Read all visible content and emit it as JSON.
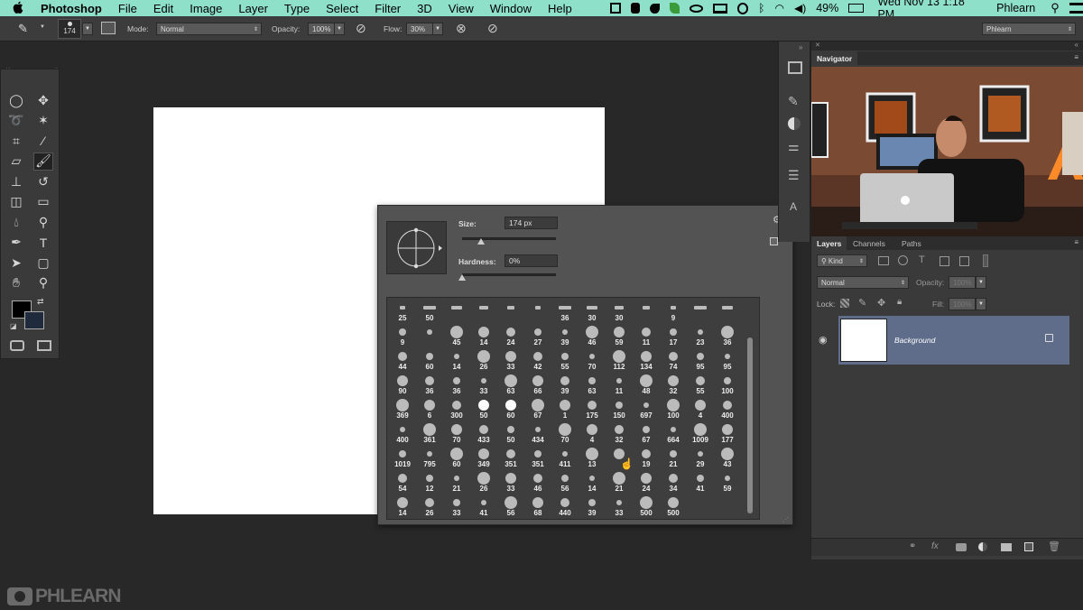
{
  "menubar": {
    "apple_icon": "apple-icon",
    "items": [
      "Photoshop",
      "File",
      "Edit",
      "Image",
      "Layer",
      "Type",
      "Select",
      "Filter",
      "3D",
      "View",
      "Window",
      "Help"
    ],
    "battery": "49%",
    "clock": "Wed Nov 13  1:18 PM",
    "user": "Phlearn"
  },
  "options": {
    "brush_size": "174",
    "mode_label": "Mode:",
    "mode_value": "Normal",
    "opacity_label": "Opacity:",
    "opacity_value": "100%",
    "flow_label": "Flow:",
    "flow_value": "30%",
    "workspace": "Phlearn"
  },
  "toolbox": {
    "tools": [
      "marquee-icon",
      "move-icon",
      "lasso-icon",
      "magic-wand-icon",
      "crop-icon",
      "eyedropper-icon",
      "healing-brush-icon",
      "brush-icon",
      "clone-stamp-icon",
      "history-brush-icon",
      "eraser-icon",
      "gradient-icon",
      "blur-icon",
      "dodge-icon",
      "pen-icon",
      "type-icon",
      "path-selection-icon",
      "rectangle-icon",
      "hand-icon",
      "zoom-icon"
    ],
    "foreground": "#000000",
    "background": "#1f2a3d"
  },
  "brush_picker": {
    "size_label": "Size:",
    "size_value": "174 px",
    "size_fraction": 0.2,
    "hardness_label": "Hardness:",
    "hardness_value": "0%",
    "hardness_fraction": 0,
    "rows": [
      [
        "25",
        "50",
        "",
        "",
        "",
        "",
        "36",
        "30",
        "30",
        "",
        "9",
        "",
        ""
      ],
      [
        "9",
        "",
        "45",
        "14",
        "24",
        "27",
        "39",
        "46",
        "59",
        "11",
        "17",
        "23",
        "36"
      ],
      [
        "44",
        "60",
        "14",
        "26",
        "33",
        "42",
        "55",
        "70",
        "112",
        "134",
        "74",
        "95",
        "95"
      ],
      [
        "90",
        "36",
        "36",
        "33",
        "63",
        "66",
        "39",
        "63",
        "11",
        "48",
        "32",
        "55",
        "100"
      ],
      [
        "369",
        "6",
        "300",
        "50",
        "60",
        "67",
        "1",
        "175",
        "150",
        "697",
        "100",
        "4",
        "400"
      ],
      [
        "400",
        "361",
        "70",
        "433",
        "50",
        "434",
        "70",
        "4",
        "32",
        "67",
        "664",
        "1009",
        "177"
      ],
      [
        "1019",
        "795",
        "60",
        "349",
        "351",
        "351",
        "411",
        "13",
        "",
        "19",
        "21",
        "29",
        "43"
      ],
      [
        "54",
        "12",
        "21",
        "26",
        "33",
        "46",
        "56",
        "14",
        "21",
        "24",
        "34",
        "41",
        "59"
      ],
      [
        "14",
        "26",
        "33",
        "41",
        "56",
        "68",
        "440",
        "39",
        "33",
        "500",
        "500"
      ]
    ]
  },
  "panels": {
    "navigator_tab": "Navigator",
    "layers_tabs": [
      "Layers",
      "Channels",
      "Paths"
    ],
    "kind_label": "Kind",
    "blend_mode": "Normal",
    "opacity_label": "Opacity:",
    "opacity_value": "100%",
    "lock_label": "Lock:",
    "fill_label": "Fill:",
    "fill_value": "100%",
    "layer_name": "Background"
  },
  "watermark": "PHLEARN",
  "colors": {
    "menubar": "#8fe0c8",
    "panel": "#3a3a3a",
    "layer_selected": "#5f6d8a"
  }
}
